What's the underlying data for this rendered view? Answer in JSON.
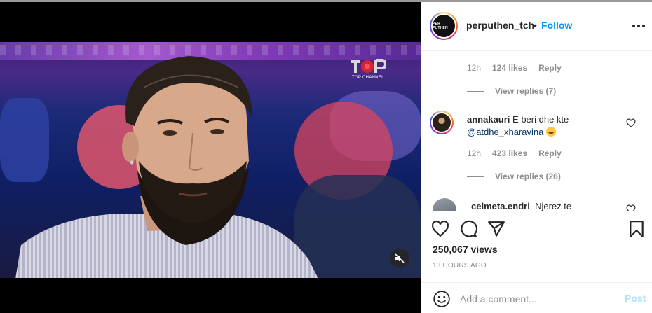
{
  "post": {
    "username": "perputhen_tch",
    "separator": "•",
    "follow_label": "Follow",
    "avatar_text": "PER PUTHEN",
    "views": "250,067 views",
    "time_ago": "13 HOURS AGO"
  },
  "video": {
    "channel_logo_text": "TOP CHANNEL",
    "muted": true
  },
  "comments": [
    {
      "time": "12h",
      "likes": "124 likes",
      "reply_label": "Reply",
      "view_replies": "View replies (7)"
    },
    {
      "username": "annakauri",
      "text": "E beri dhe kte",
      "mention": "@atdhe_xharavina",
      "time": "12h",
      "likes": "423 likes",
      "reply_label": "Reply",
      "view_replies": "View replies (26)"
    },
    {
      "username": "celmeta.endri",
      "text": "Njerez te"
    }
  ],
  "composer": {
    "placeholder": "Add a comment...",
    "post_label": "Post"
  },
  "icons": {
    "like": "heart-icon",
    "comment": "comment-icon",
    "share": "share-icon",
    "save": "bookmark-icon",
    "emoji": "smile-icon",
    "mute": "speaker-muted-icon",
    "more": "more-options-icon"
  },
  "colors": {
    "follow": "#0095f6",
    "post_disabled": "#b2dffc",
    "mention": "#00376b",
    "meta_gray": "#8e8e8e"
  }
}
